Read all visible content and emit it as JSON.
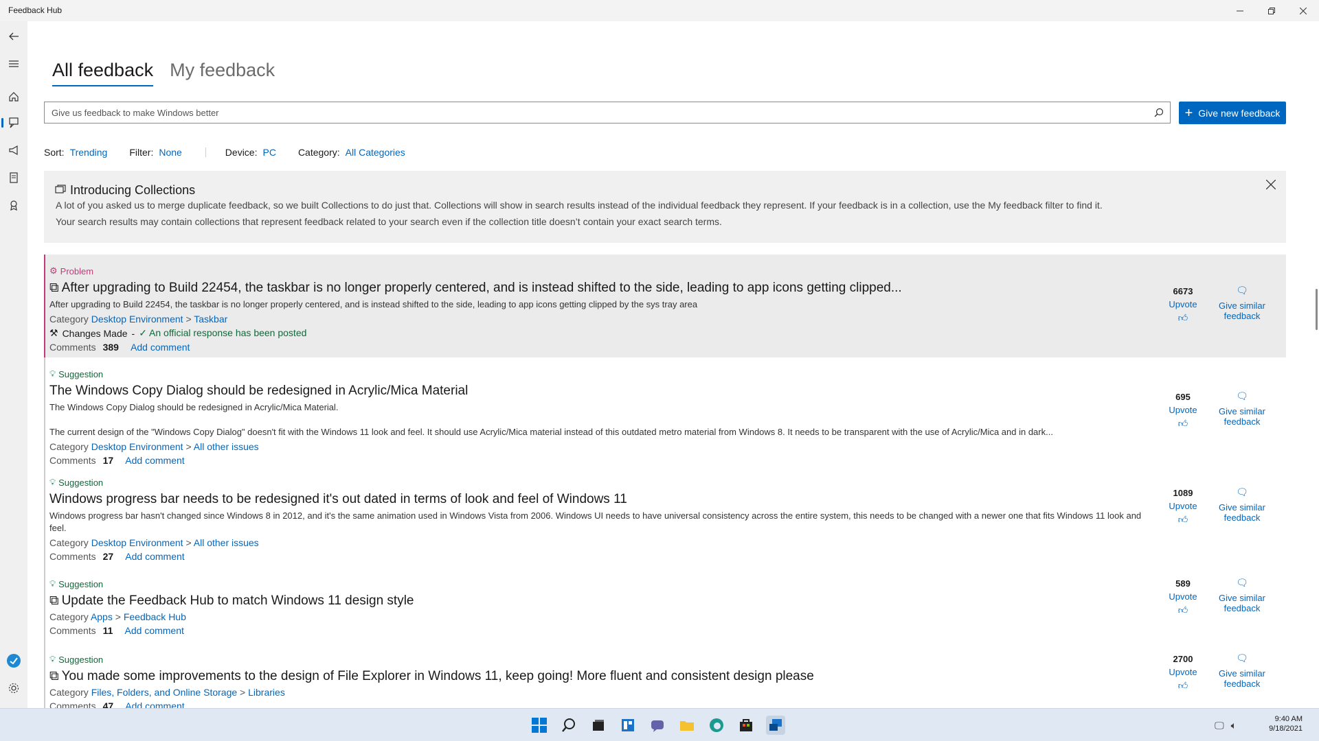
{
  "window": {
    "title": "Feedback Hub"
  },
  "tabs": [
    {
      "label": "All feedback",
      "active": true
    },
    {
      "label": "My feedback",
      "active": false
    }
  ],
  "search": {
    "placeholder": "Give us feedback to make Windows better"
  },
  "give_button": {
    "label": "Give new feedback"
  },
  "filters": {
    "sort_label": "Sort:",
    "sort_value": "Trending",
    "filter_label": "Filter:",
    "filter_value": "None",
    "device_label": "Device:",
    "device_value": "PC",
    "category_label": "Category:",
    "category_value": "All Categories"
  },
  "banner": {
    "title": "Introducing Collections",
    "line1": "A lot of you asked us to merge duplicate feedback, so we built Collections to do just that. Collections will show in search results instead of the individual feedback they represent. If your feedback is in a collection, use the My feedback filter to find it.",
    "line2": "Your search results may contain collections that represent feedback related to your search even if the collection title doesn’t contain your exact search terms."
  },
  "labels": {
    "category": "Category",
    "comments": "Comments",
    "add_comment": "Add comment",
    "upvote": "Upvote",
    "give_similar_1": "Give similar",
    "give_similar_2": "feedback",
    "separator": ">",
    "dash": "-"
  },
  "feedback": [
    {
      "type": "Problem",
      "title": "After upgrading to Build 22454, the taskbar is no longer properly centered, and is instead shifted to the side, leading to app icons getting clipped...",
      "desc": "After upgrading to Build 22454, the taskbar is no longer properly centered, and is instead shifted to the side, leading to app icons getting clipped by the sys tray area",
      "category": "Desktop Environment",
      "subcategory": "Taskbar",
      "status": "Changes Made",
      "official": "An official response has been posted",
      "comments": "389",
      "votes": "6673"
    },
    {
      "type": "Suggestion",
      "title": "The Windows Copy Dialog should be redesigned in Acrylic/Mica Material",
      "desc": "The Windows Copy Dialog should be redesigned in Acrylic/Mica Material.",
      "desc2": "The current design of the \"Windows Copy Dialog\" doesn't fit with the Windows 11 look and feel. It should use Acrylic/Mica material instead of this outdated metro material from Windows 8. It needs to be transparent with the use of Acrylic/Mica and in dark...",
      "category": "Desktop Environment",
      "subcategory": "All other issues",
      "comments": "17",
      "votes": "695"
    },
    {
      "type": "Suggestion",
      "title": "Windows progress bar needs to be redesigned it's out dated in terms of look and feel of Windows 11",
      "desc": "Windows progress bar hasn't changed since Windows 8 in 2012, and it's the same animation used in Windows Vista from 2006. Windows UI needs to have universal consistency across the entire system, this needs to be changed with a newer one that fits Windows 11 look and feel.",
      "category": "Desktop Environment",
      "subcategory": "All other issues",
      "comments": "27",
      "votes": "1089"
    },
    {
      "type": "Suggestion",
      "title": "Update the Feedback Hub to match Windows 11 design style",
      "category": "Apps",
      "subcategory": "Feedback Hub",
      "comments": "11",
      "votes": "589"
    },
    {
      "type": "Suggestion",
      "title": "You made some improvements to the design of File Explorer in Windows 11, keep going! More fluent and consistent design please",
      "category": "Files, Folders, and Online Storage",
      "subcategory": "Libraries",
      "comments": "47",
      "votes": "2700"
    }
  ],
  "tray": {
    "time": "9:40 AM",
    "date": "9/18/2021"
  },
  "colors": {
    "accent": "#0067c0",
    "problem": "#c2397a",
    "suggestion": "#0c6b3a"
  }
}
